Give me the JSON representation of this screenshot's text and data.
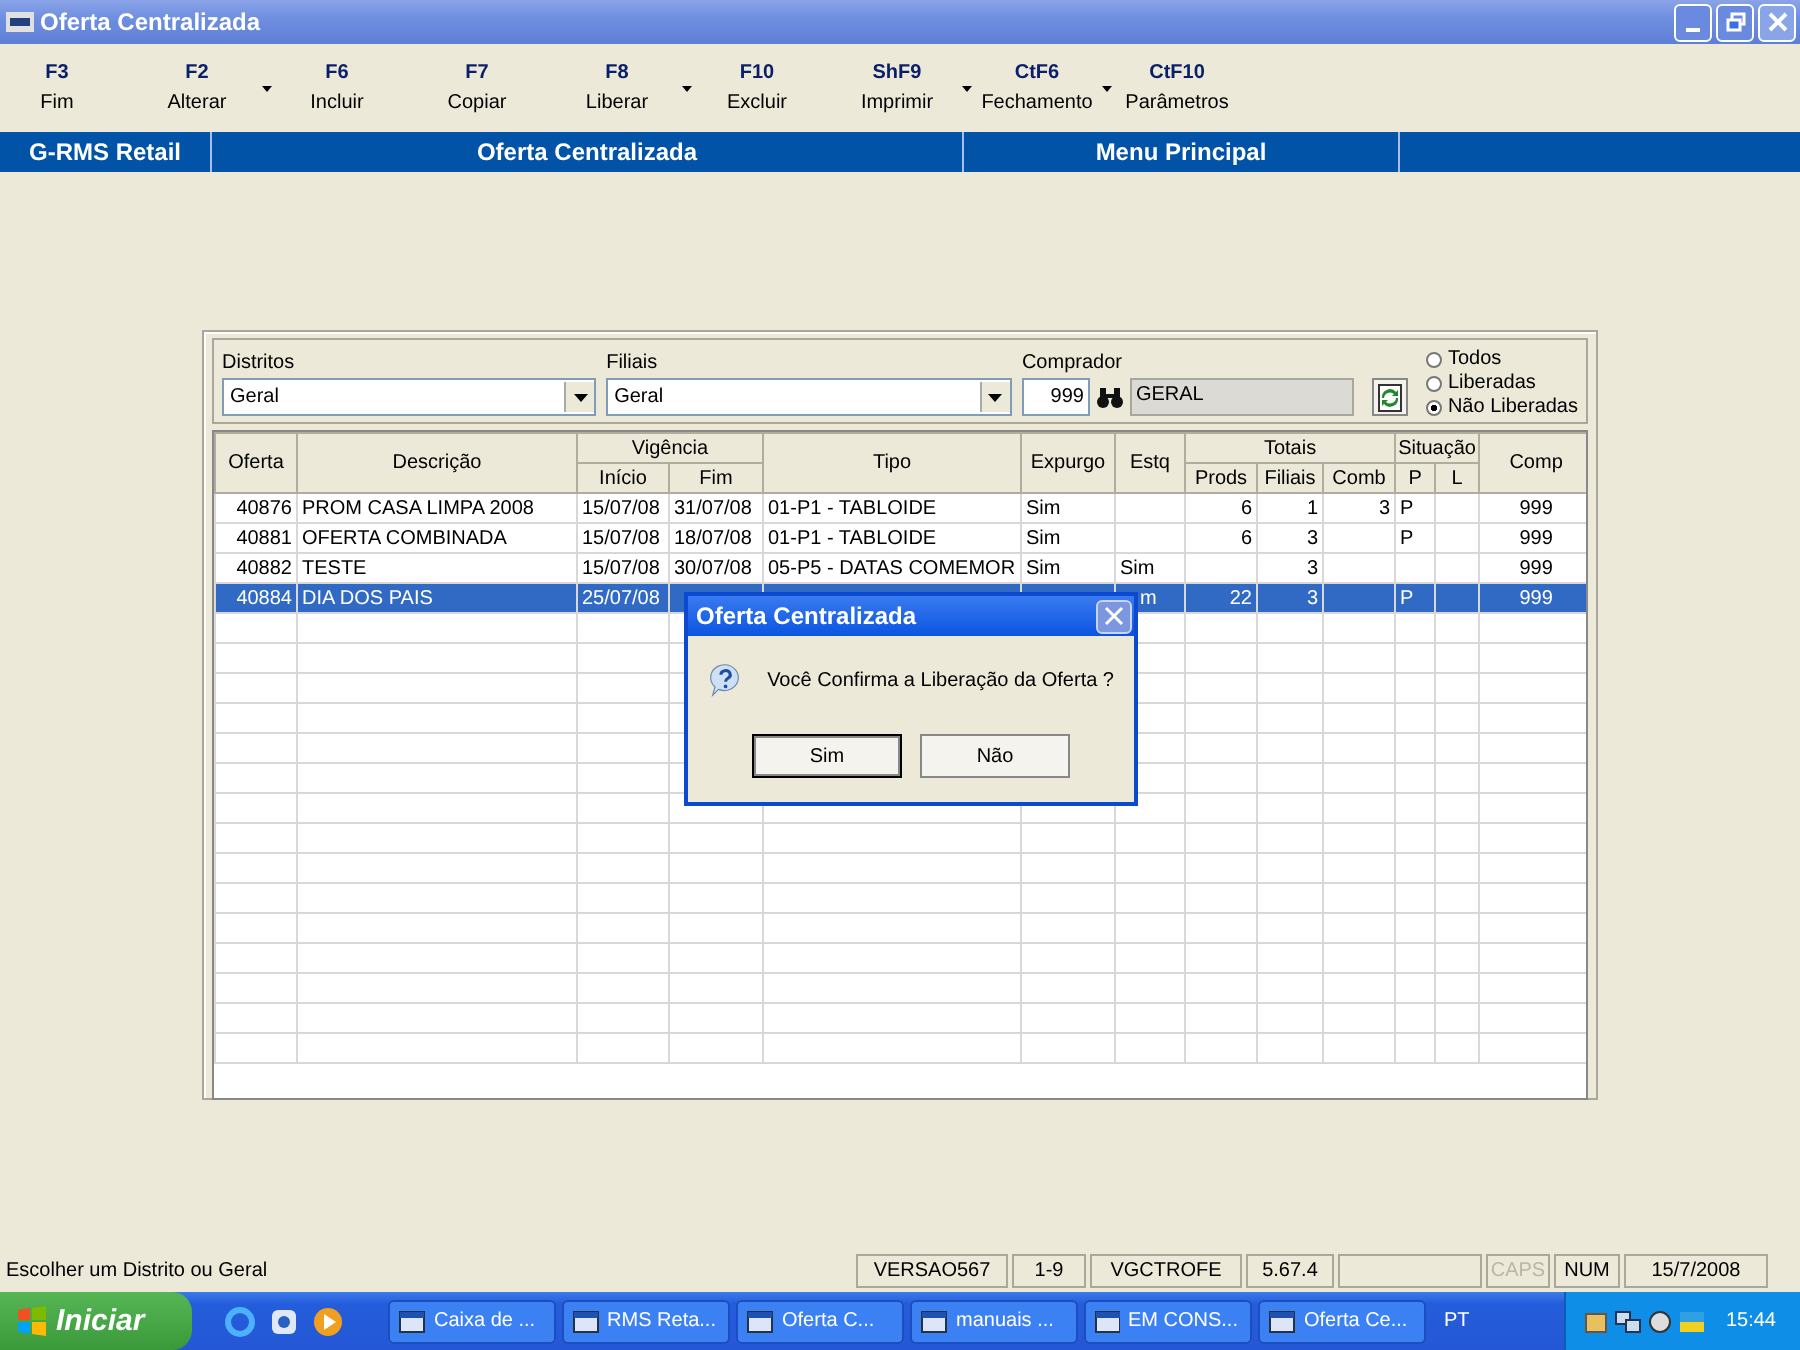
{
  "window": {
    "title": "Oferta Centralizada"
  },
  "toolbar": [
    {
      "key": "F3",
      "label": "Fim",
      "dropdown": false
    },
    {
      "key": "F2",
      "label": "Alterar",
      "dropdown": true
    },
    {
      "key": "F6",
      "label": "Incluir",
      "dropdown": false
    },
    {
      "key": "F7",
      "label": "Copiar",
      "dropdown": false
    },
    {
      "key": "F8",
      "label": "Liberar",
      "dropdown": true
    },
    {
      "key": "F10",
      "label": "Excluir",
      "dropdown": false
    },
    {
      "key": "ShF9",
      "label": "Imprimir",
      "dropdown": true
    },
    {
      "key": "CtF6",
      "label": "Fechamento",
      "dropdown": true
    },
    {
      "key": "CtF10",
      "label": "Parâmetros",
      "dropdown": false
    }
  ],
  "menu_band": [
    "G-RMS Retail",
    "Oferta Centralizada",
    "Menu Principal"
  ],
  "filters": {
    "distritos": {
      "label": "Distritos",
      "value": "Geral"
    },
    "filiais": {
      "label": "Filiais",
      "value": "Geral"
    },
    "comprador": {
      "label": "Comprador",
      "code": "999",
      "name": "GERAL"
    },
    "status_options": [
      {
        "label": "Todos",
        "selected": false
      },
      {
        "label": "Liberadas",
        "selected": false
      },
      {
        "label": "Não Liberadas",
        "selected": true
      }
    ]
  },
  "table": {
    "header": [
      {
        "label": "Oferta"
      },
      {
        "label": "Descrição"
      },
      {
        "label": "Vigência",
        "children": [
          {
            "label": "Início"
          },
          {
            "label": "Fim"
          }
        ]
      },
      {
        "label": "Tipo"
      },
      {
        "label": "Expurgo"
      },
      {
        "label": "Estq"
      },
      {
        "label": "Totais",
        "children": [
          {
            "label": "Prods"
          },
          {
            "label": "Filiais"
          },
          {
            "label": "Comb"
          }
        ]
      },
      {
        "label": "Situação",
        "children": [
          {
            "label": "P"
          },
          {
            "label": "L"
          }
        ]
      },
      {
        "label": "Comp"
      }
    ],
    "rows": [
      {
        "selected": false,
        "cells": [
          "40876",
          "PROM CASA LIMPA 2008",
          "15/07/08",
          "31/07/08",
          "01-P1 - TABLOIDE",
          "Sim",
          "",
          "6",
          "1",
          "3",
          "P",
          "",
          "999"
        ]
      },
      {
        "selected": false,
        "cells": [
          "40881",
          "OFERTA COMBINADA",
          "15/07/08",
          "18/07/08",
          "01-P1 - TABLOIDE",
          "Sim",
          "",
          "6",
          "3",
          "",
          "P",
          "",
          "999"
        ]
      },
      {
        "selected": false,
        "cells": [
          "40882",
          "TESTE",
          "15/07/08",
          "30/07/08",
          "05-P5 - DATAS COMEMOR",
          "Sim",
          "Sim",
          "",
          "3",
          "",
          "",
          "",
          "999"
        ]
      },
      {
        "selected": true,
        "cells": [
          "40884",
          "DIA DOS PAIS",
          "25/07/08",
          "",
          "",
          "",
          "m",
          "22",
          "3",
          "",
          "P",
          "",
          "999"
        ]
      }
    ]
  },
  "dialog": {
    "title": "Oferta Centralizada",
    "message": "Você Confirma a Liberação da Oferta ?",
    "buttons": [
      {
        "label": "Sim",
        "default": true
      },
      {
        "label": "Não",
        "default": false
      }
    ]
  },
  "status_bar": {
    "message": "Escolher um Distrito ou Geral",
    "panels": [
      {
        "text": "VERSAO567",
        "on": true
      },
      {
        "text": "1-9",
        "on": true
      },
      {
        "text": "VGCTROFE",
        "on": true
      },
      {
        "text": "5.67.4",
        "on": true
      },
      {
        "text": "CAPS",
        "on": false
      },
      {
        "text": "NUM",
        "on": true
      },
      {
        "text": "15/7/2008",
        "on": true
      }
    ]
  },
  "taskbar": {
    "start": "Iniciar",
    "tasks": [
      "Caixa de ...",
      "RMS Reta...",
      "Oferta C...",
      "manuais ...",
      "EM CONS...",
      "Oferta Ce..."
    ],
    "language": "PT",
    "clock": "15:44"
  }
}
